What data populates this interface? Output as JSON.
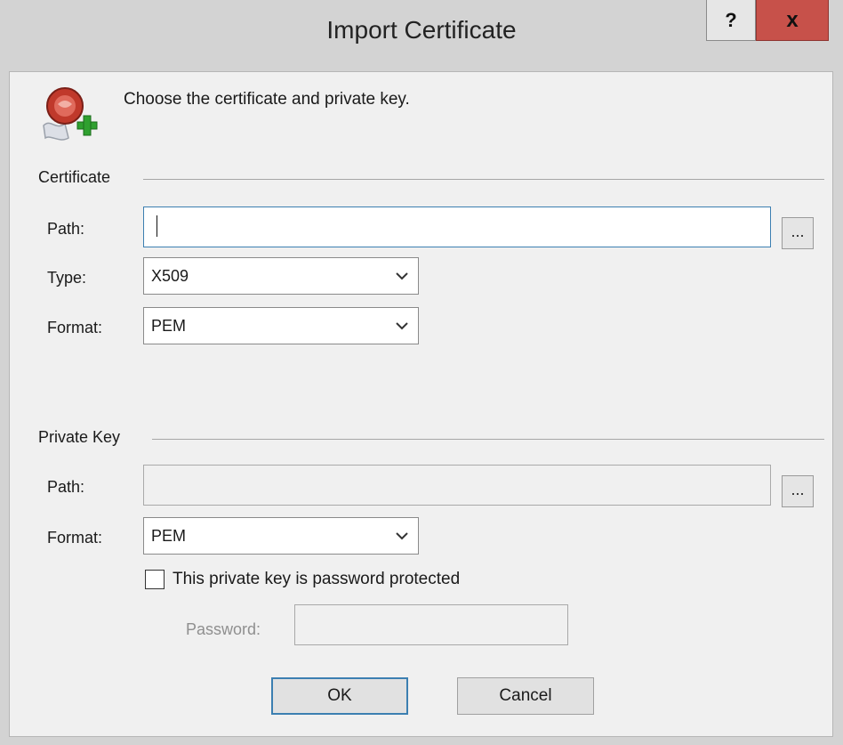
{
  "dialog": {
    "title": "Import Certificate",
    "help_label": "?",
    "close_label": "x",
    "header_icon": "certificate-seal-add-icon",
    "instruction": "Choose the certificate and private key."
  },
  "certificate": {
    "group_label": "Certificate",
    "path_label": "Path:",
    "path_value": "",
    "browse_label": "...",
    "type_label": "Type:",
    "type_value": "X509",
    "format_label": "Format:",
    "format_value": "PEM"
  },
  "private_key": {
    "group_label": "Private Key",
    "path_label": "Path:",
    "path_value": "",
    "browse_label": "...",
    "format_label": "Format:",
    "format_value": "PEM",
    "password_protected_label": "This private key is password protected",
    "password_protected_checked": false,
    "password_label": "Password:",
    "password_value": ""
  },
  "buttons": {
    "ok_label": "OK",
    "cancel_label": "Cancel"
  },
  "colors": {
    "close_button": "#c7514a",
    "focus_border": "#3c7fb1",
    "dialog_background": "#f0f0f0"
  }
}
